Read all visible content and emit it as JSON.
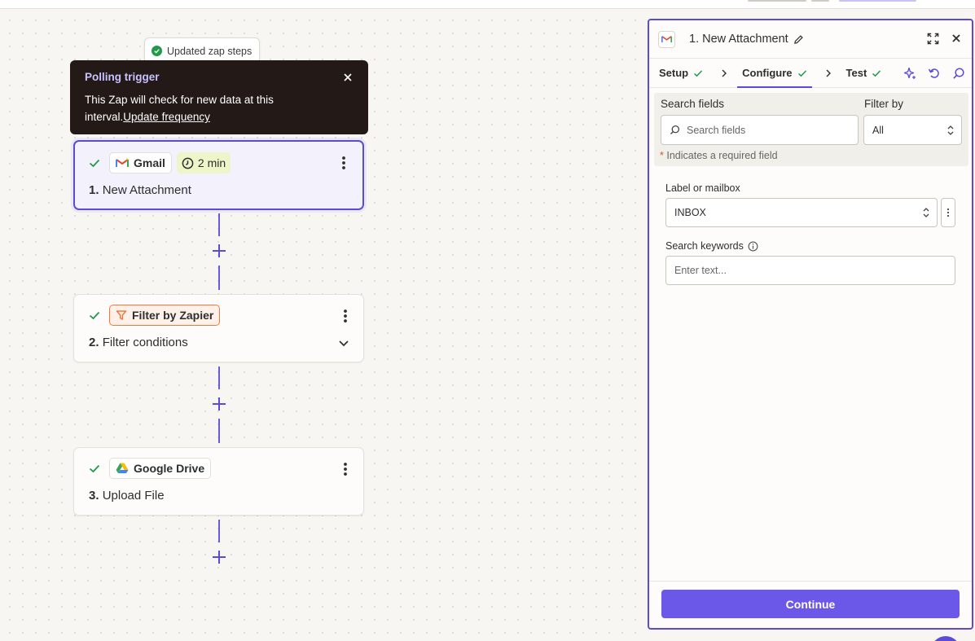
{
  "toast": {
    "text": "Updated zap steps"
  },
  "tooltip": {
    "title": "Polling trigger",
    "body": "This Zap will check for new data at this interval.",
    "link": "Update frequency"
  },
  "steps": [
    {
      "app": "Gmail",
      "badge": "2 min",
      "number": "1.",
      "name": "New Attachment"
    },
    {
      "app": "Filter by Zapier",
      "number": "2.",
      "name": "Filter conditions"
    },
    {
      "app": "Google Drive",
      "number": "3.",
      "name": "Upload File"
    }
  ],
  "panel": {
    "title": "1. New Attachment",
    "tabs": [
      "Setup",
      "Configure",
      "Test"
    ],
    "search_label": "Search fields",
    "search_placeholder": "Search fields",
    "filter_label": "Filter by",
    "filter_value": "All",
    "required_note": "Indicates a required field",
    "required_star": "*",
    "fields": [
      {
        "label": "Label or mailbox",
        "value": "INBOX"
      },
      {
        "label": "Search keywords",
        "placeholder": "Enter text..."
      }
    ],
    "continue_label": "Continue"
  },
  "colors": {
    "accent": "#5c4bd8",
    "button": "#6b57e8",
    "success": "#1f9a4a",
    "filter": "#f07a3c"
  }
}
